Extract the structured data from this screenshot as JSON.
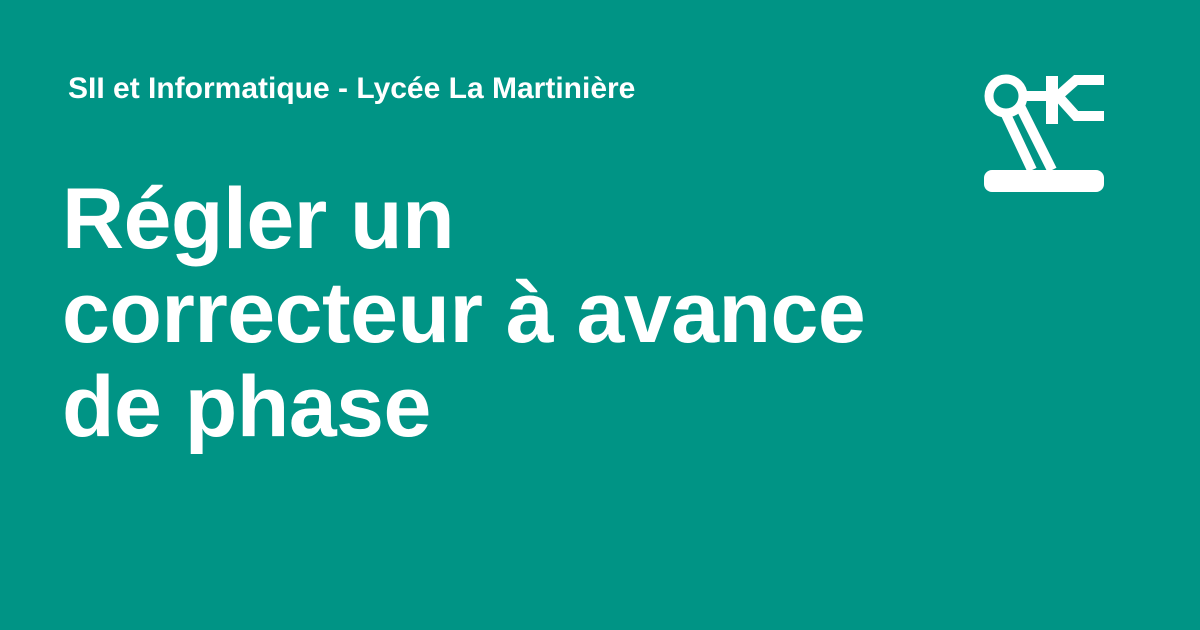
{
  "header": {
    "site_name": "SII et Informatique - Lycée La Martinière"
  },
  "main": {
    "title_lines": [
      "Régler un",
      "correcteur à avance",
      "de phase"
    ]
  },
  "logo": {
    "icon": "robot-arm-icon"
  },
  "colors": {
    "background": "#009485",
    "foreground": "#ffffff"
  }
}
